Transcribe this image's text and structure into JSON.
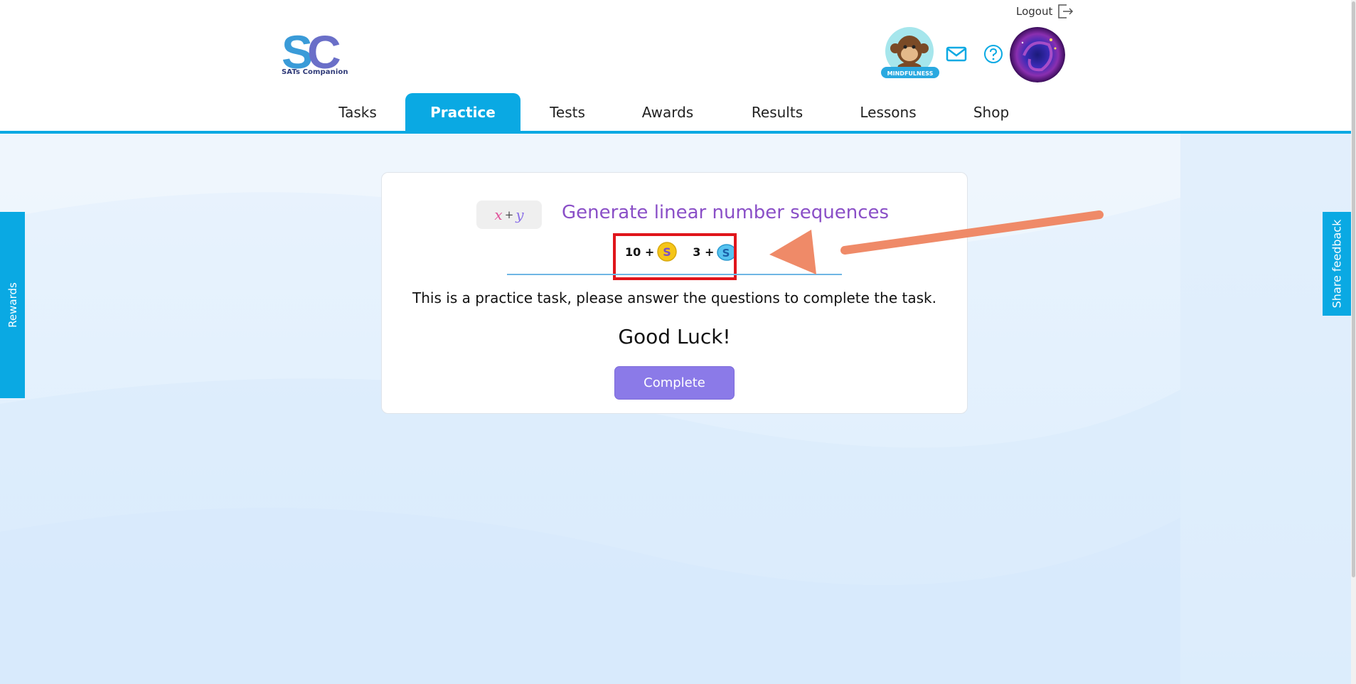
{
  "header": {
    "logo_text": "SATs Companion",
    "logout_label": "Logout",
    "avatar_badge": "MINDFULNESS"
  },
  "nav": {
    "items": [
      {
        "label": "Tasks"
      },
      {
        "label": "Practice",
        "active": true
      },
      {
        "label": "Tests"
      },
      {
        "label": "Awards"
      },
      {
        "label": "Results"
      },
      {
        "label": "Lessons"
      },
      {
        "label": "Shop"
      }
    ]
  },
  "side_tabs": {
    "left": "Rewards",
    "right": "Share feedback"
  },
  "task": {
    "icon": {
      "x": "x",
      "plus": "+",
      "y": "y"
    },
    "title": "Generate linear number sequences",
    "rewards": [
      {
        "amount": "10 +",
        "icon": "gold-coin-icon"
      },
      {
        "amount": "3 +",
        "icon": "blue-gem-icon"
      }
    ],
    "description": "This is a practice task, please answer the questions to complete the task.",
    "good_luck": "Good Luck!",
    "complete_label": "Complete"
  },
  "colors": {
    "accent": "#0aa9e3",
    "title": "#8a4fc7",
    "button": "#8b7ae8",
    "highlight_box": "#e0151b",
    "annotation_arrow": "#ef8a68"
  }
}
